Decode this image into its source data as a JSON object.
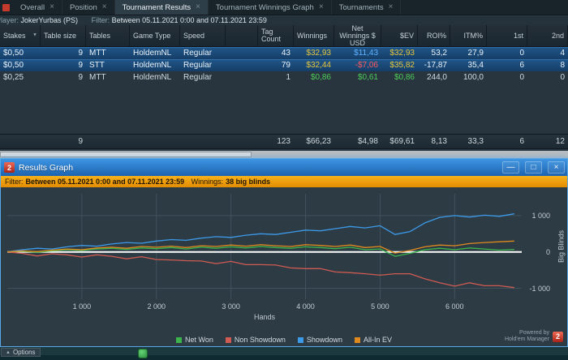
{
  "tabs": {
    "active_index": 2,
    "close_glyph": "×",
    "items": [
      {
        "label": "Overall"
      },
      {
        "label": "Position"
      },
      {
        "label": "Tournament Results"
      },
      {
        "label": "Tournament Winnings Graph"
      },
      {
        "label": "Tournaments"
      }
    ]
  },
  "player_bar": {
    "player_label": "Player:",
    "player_value": "JokerYurbas (PS)",
    "filter_label": "Filter:",
    "filter_value": "Between 05.11.2021 0:00 and 07.11.2021 23:59"
  },
  "table": {
    "columns": [
      {
        "key": "stakes",
        "label": "Stakes",
        "head": "left",
        "cell": "left",
        "dropdown": true
      },
      {
        "key": "table-size",
        "label": "Table size",
        "head": "left",
        "cell": "right"
      },
      {
        "key": "tables",
        "label": "Tables",
        "head": "left",
        "cell": "left"
      },
      {
        "key": "game-type",
        "label": "Game Type",
        "head": "left",
        "cell": "left"
      },
      {
        "key": "speed",
        "label": "Speed",
        "head": "left",
        "cell": "left"
      },
      {
        "key": "spacer",
        "label": "",
        "head": "left",
        "cell": "left"
      },
      {
        "key": "tag-count",
        "label": "Tag Count",
        "head": "left",
        "cell": "right"
      },
      {
        "key": "winnings",
        "label": "Winnings",
        "head": "left",
        "cell": "right"
      },
      {
        "key": "net-winnings",
        "label": "Net Winnings $ USD",
        "head": "center",
        "cell": "right"
      },
      {
        "key": "ev",
        "label": "$EV",
        "head": "right",
        "cell": "right"
      },
      {
        "key": "roi",
        "label": "ROI%",
        "head": "right",
        "cell": "right"
      },
      {
        "key": "itm",
        "label": "ITM%",
        "head": "right",
        "cell": "right"
      },
      {
        "key": "first",
        "label": "1st",
        "head": "right",
        "cell": "right"
      },
      {
        "key": "second",
        "label": "2nd",
        "head": "right",
        "cell": "right"
      }
    ],
    "rows": [
      {
        "selected": true,
        "cells": [
          "$0,50",
          "9",
          "MTT",
          "HoldemNL",
          "Regular",
          "",
          "43",
          "$32,93",
          "$11,43",
          "$32,93",
          "53,2",
          "27,9",
          "0",
          "4"
        ],
        "colors": {
          "7": "#e5c63e",
          "8": "#5fb2ff",
          "9": "#e5c63e"
        }
      },
      {
        "selected": true,
        "cells": [
          "$0,50",
          "9",
          "STT",
          "HoldemNL",
          "Regular",
          "",
          "79",
          "$32,44",
          "-$7,06",
          "$35,82",
          "-17,87",
          "35,4",
          "6",
          "8"
        ],
        "colors": {
          "7": "#e5c63e",
          "8": "#ff5a5a",
          "9": "#e5c63e"
        }
      },
      {
        "selected": false,
        "cells": [
          "$0,25",
          "9",
          "MTT",
          "HoldemNL",
          "Regular",
          "",
          "1",
          "$0,86",
          "$0,61",
          "$0,86",
          "244,0",
          "100,0",
          "0",
          "0"
        ],
        "colors": {
          "7": "#4ecb59",
          "8": "#4ecb59",
          "9": "#4ecb59"
        }
      }
    ],
    "summary": [
      "",
      "9",
      "",
      "",
      "",
      "",
      "123",
      "$66,23",
      "$4,98",
      "$69,61",
      "8,13",
      "33,3",
      "6",
      "12"
    ]
  },
  "popup": {
    "title": "Results Graph",
    "icon_text": "2",
    "buttons": {
      "minimize": "—",
      "maximize": "□",
      "close": "×"
    },
    "filter": {
      "label": "Filter:",
      "value": "Between 05.11.2021 0:00 and 07.11.2021 23:59",
      "winnings_label": "Winnings:",
      "winnings_value": "38 big blinds"
    },
    "powered_by": {
      "line1": "Powered by",
      "line2": "Hold'em Manager",
      "logo_text": "2"
    }
  },
  "chart_data": {
    "type": "line",
    "title": "Results Graph",
    "xlabel": "Hands",
    "ylabel": "Big Blinds",
    "xlim": [
      0,
      6900
    ],
    "ylim": [
      -1300,
      1600
    ],
    "grid": true,
    "grid_color": "#41525c",
    "zero_line_color": "#ffffff",
    "legend_position": "bottom",
    "x_ticks": [
      {
        "v": 1000,
        "label": "1 000"
      },
      {
        "v": 2000,
        "label": "2 000"
      },
      {
        "v": 3000,
        "label": "3 000"
      },
      {
        "v": 4000,
        "label": "4 000"
      },
      {
        "v": 5000,
        "label": "5 000"
      },
      {
        "v": 6000,
        "label": "6 000"
      }
    ],
    "y_ticks": [
      {
        "v": 1000,
        "label": "1 000"
      },
      {
        "v": 0,
        "label": "0"
      },
      {
        "v": -1000,
        "label": "-1 000"
      }
    ],
    "x": [
      0,
      200,
      400,
      600,
      800,
      1000,
      1200,
      1400,
      1600,
      1800,
      2000,
      2200,
      2400,
      2600,
      2800,
      3000,
      3200,
      3400,
      3600,
      3800,
      4000,
      4200,
      4400,
      4600,
      4800,
      5000,
      5200,
      5400,
      5600,
      5800,
      6000,
      6200,
      6400,
      6600,
      6800
    ],
    "series": [
      {
        "name": "Net Won",
        "color": "#3cb44b",
        "values": [
          0,
          20,
          -10,
          30,
          60,
          40,
          80,
          100,
          70,
          110,
          90,
          120,
          80,
          130,
          100,
          140,
          110,
          150,
          120,
          100,
          140,
          120,
          90,
          130,
          60,
          80,
          -120,
          -40,
          60,
          100,
          60,
          110,
          80,
          50,
          70
        ]
      },
      {
        "name": "Non Showdown",
        "color": "#cf5b52",
        "values": [
          0,
          -40,
          -110,
          -50,
          -80,
          -140,
          -80,
          -120,
          -190,
          -130,
          -210,
          -220,
          -240,
          -250,
          -320,
          -260,
          -350,
          -350,
          -360,
          -440,
          -460,
          -460,
          -550,
          -570,
          -600,
          -640,
          -600,
          -600,
          -740,
          -850,
          -940,
          -850,
          -930,
          -930,
          -980
        ]
      },
      {
        "name": "Showdown",
        "color": "#3d9ae8",
        "values": [
          0,
          60,
          100,
          80,
          140,
          180,
          160,
          220,
          260,
          240,
          300,
          340,
          320,
          380,
          420,
          400,
          460,
          500,
          480,
          540,
          600,
          580,
          640,
          700,
          660,
          720,
          480,
          560,
          800,
          950,
          1000,
          960,
          1010,
          980,
          1050
        ]
      },
      {
        "name": "All-In EV",
        "color": "#df8a1f",
        "values": [
          0,
          30,
          10,
          50,
          80,
          60,
          110,
          130,
          100,
          150,
          130,
          160,
          120,
          170,
          150,
          190,
          160,
          200,
          170,
          150,
          200,
          180,
          150,
          190,
          120,
          150,
          -30,
          40,
          140,
          190,
          170,
          230,
          260,
          280,
          300
        ]
      }
    ]
  },
  "bottom": {
    "options_label": "Options"
  }
}
